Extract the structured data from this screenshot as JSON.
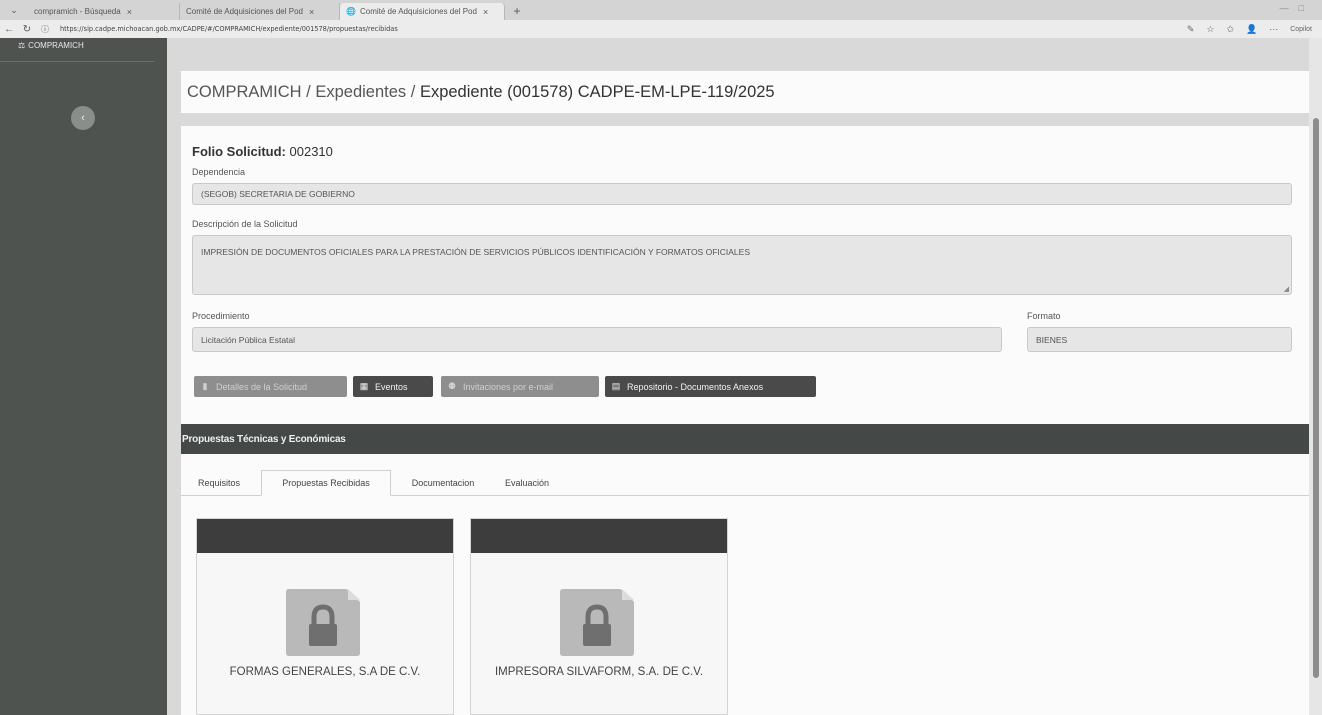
{
  "browser": {
    "tabs": [
      {
        "label": "compramich - Búsqueda",
        "close": "×"
      },
      {
        "label": "Comité de Adquisiciones del Pod",
        "close": "×"
      },
      {
        "label": "Comité de Adquisiciones del Pod",
        "close": "×"
      }
    ],
    "new_tab": "+",
    "url": "https://sip.cadpe.michoacan.gob.mx/CADPE/#/COMPRAMICH/expediente/001578/propuestas/recibidas",
    "copilot": "Copilot"
  },
  "sidebar": {
    "brand": "COMPRAMICH",
    "collapse_icon": "‹"
  },
  "breadcrumb": {
    "part1": "COMPRAMICH",
    "sep1": " / ",
    "part2": "Expedientes",
    "sep2": " / ",
    "current": "Expediente (001578) CADPE-EM-LPE-119/2025"
  },
  "solicitud": {
    "folio_label": "Folio Solicitud:",
    "folio_value": "002310",
    "dependencia_label": "Dependencia",
    "dependencia_value": "(SEGOB) SECRETARIA DE GOBIERNO",
    "descripcion_label": "Descripción de la Solicitud",
    "descripcion_value": "IMPRESIÓN DE DOCUMENTOS OFICIALES PARA LA PRESTACIÓN DE SERVICIOS PÚBLICOS IDENTIFICACIÓN Y FORMATOS OFICIALES",
    "procedimiento_label": "Procedimiento",
    "procedimiento_value": "Licitación Pública Estatal",
    "formato_label": "Formato",
    "formato_value": "BIENES"
  },
  "actions": {
    "detalles": "Detalles de la Solicitud",
    "eventos": "Eventos",
    "invitaciones": "Invitaciones por e-mail",
    "repositorio": "Repositorio - Documentos Anexos"
  },
  "propuestas": {
    "header": "Propuestas Técnicas y Económicas",
    "tabs": [
      "Requisitos",
      "Propuestas Recibidas",
      "Documentacion",
      "Evaluación"
    ],
    "active_tab": "Propuestas Recibidas",
    "cards": [
      {
        "name": "FORMAS GENERALES, S.A DE C.V.",
        "icon": "locked-folder-icon"
      },
      {
        "name": "IMPRESORA SILVAFORM, S.A. DE C.V.",
        "icon": "locked-folder-icon"
      }
    ]
  },
  "colors": {
    "sidebar": "#4e5350",
    "header_bar": "#444846",
    "card_header": "#3d3d3d",
    "folder": "#b9b9b9"
  }
}
